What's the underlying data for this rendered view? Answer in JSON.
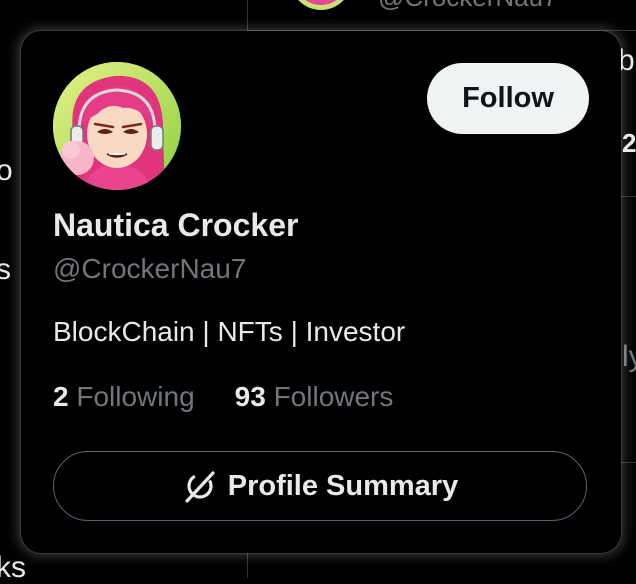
{
  "background": {
    "fragments": {
      "left_o": "o",
      "left_s": "s",
      "left_ks": "ks",
      "right_b": "b",
      "right_2": "2",
      "right_ly": "ly"
    },
    "top_handle_peek": "@CrockerNau7"
  },
  "card": {
    "avatar_icon": "cartoon-avatar-pink-hair",
    "follow_label": "Follow",
    "display_name": "Nautica Crocker",
    "handle": "@CrockerNau7",
    "bio": "BlockChain | NFTs | Investor",
    "following": {
      "count": "2",
      "label": "Following"
    },
    "followers": {
      "count": "93",
      "label": "Followers"
    },
    "summary_icon": "grok-icon",
    "summary_label": "Profile Summary"
  },
  "colors": {
    "background": "#000000",
    "text_primary": "#e7e9ea",
    "text_secondary": "#71767b",
    "follow_button_bg": "#eff3f4",
    "follow_button_text": "#0f1419",
    "border": "#536471"
  }
}
